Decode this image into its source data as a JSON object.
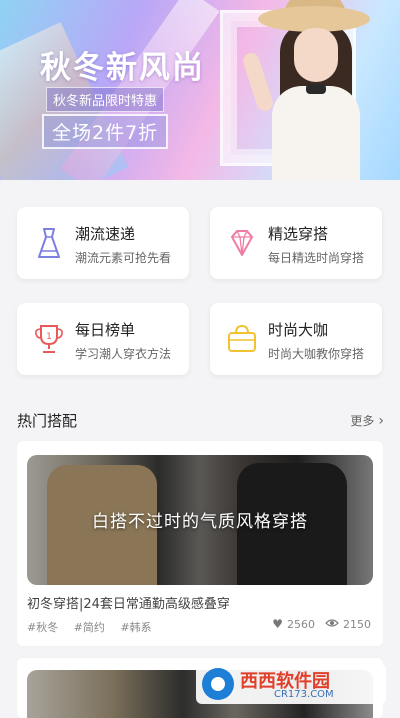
{
  "banner": {
    "title": "秋冬新风尚",
    "subtitle": "秋冬新品限时特惠",
    "promo": "全场2件7折"
  },
  "categories": [
    {
      "title": "潮流速递",
      "subtitle": "潮流元素可抢先看",
      "icon": "dress-icon",
      "icon_color": "#7b7fe0"
    },
    {
      "title": "精选穿搭",
      "subtitle": "每日精选时尚穿搭",
      "icon": "diamond-icon",
      "icon_color": "#f07ca6"
    },
    {
      "title": "每日榜单",
      "subtitle": "学习潮人穿衣方法",
      "icon": "trophy-icon",
      "icon_color": "#e85a5a"
    },
    {
      "title": "时尚大咖",
      "subtitle": "时尚大咖教你穿搭",
      "icon": "handbag-icon",
      "icon_color": "#f2c230"
    }
  ],
  "section": {
    "title": "热门搭配",
    "more": "更多"
  },
  "feed": [
    {
      "overlay": "白搭不过时的气质风格穿搭",
      "description": "初冬穿搭|24套日常通勤高级感叠穿",
      "tags": [
        "#秋冬",
        "#简约",
        "#韩系"
      ],
      "likes": "2560",
      "views": "2150"
    }
  ],
  "watermark": {
    "name": "西西软件园",
    "url": "CR173.COM"
  }
}
